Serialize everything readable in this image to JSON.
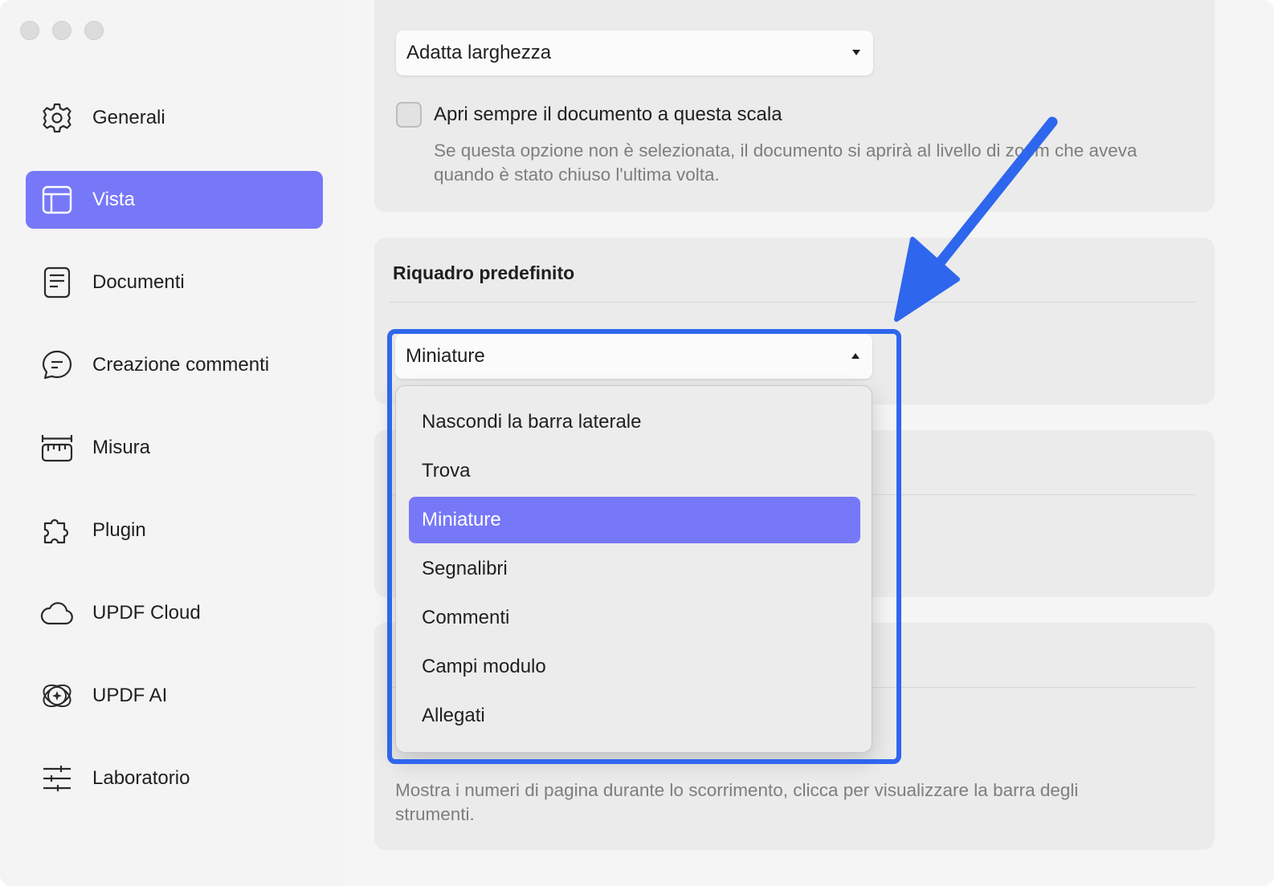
{
  "sidebar": {
    "items": [
      {
        "label": "Generali",
        "icon": "gear-icon"
      },
      {
        "label": "Vista",
        "icon": "layout-icon",
        "active": true
      },
      {
        "label": "Documenti",
        "icon": "document-icon"
      },
      {
        "label": "Creazione commenti",
        "icon": "comment-icon"
      },
      {
        "label": "Misura",
        "icon": "ruler-icon"
      },
      {
        "label": "Plugin",
        "icon": "puzzle-icon"
      },
      {
        "label": "UPDF Cloud",
        "icon": "cloud-icon"
      },
      {
        "label": "UPDF AI",
        "icon": "ai-icon"
      },
      {
        "label": "Laboratorio",
        "icon": "sliders-icon"
      }
    ]
  },
  "zoom": {
    "select_value": "Adatta larghezza",
    "checkbox_label": "Apri sempre il documento a questa scala",
    "checkbox_checked": false,
    "description": "Se questa opzione non è selezionata, il documento si aprirà al livello di zoom che aveva quando è stato chiuso l'ultima volta."
  },
  "default_pane": {
    "title": "Riquadro predefinito",
    "select_value": "Miniature",
    "options": [
      "Nascondi la barra laterale",
      "Trova",
      "Miniature",
      "Segnalibri",
      "Commenti",
      "Campi modulo",
      "Allegati"
    ],
    "selected_index": 2
  },
  "page_numbers": {
    "description": "Mostra i numeri di pagina durante lo scorrimento, clicca per visualizzare la barra degli strumenti."
  },
  "colors": {
    "accent": "#7778f8",
    "annotation": "#2f66ee"
  }
}
